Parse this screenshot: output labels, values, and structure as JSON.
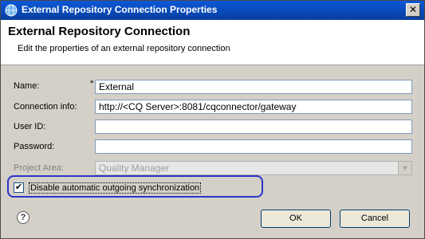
{
  "window": {
    "title": "External Repository Connection Properties",
    "close_glyph": "✕"
  },
  "header": {
    "title": "External Repository Connection",
    "description": "Edit the properties of an external repository connection"
  },
  "form": {
    "name_label": "Name:",
    "required_mark": "*",
    "name_value": "External",
    "connection_label": "Connection info:",
    "connection_value": "http://<CQ Server>:8081/cqconnector/gateway",
    "userid_label": "User ID:",
    "userid_value": "",
    "password_label": "Password:",
    "password_value": "",
    "project_area_label": "Project Area:",
    "project_area_value": "Quality Manager"
  },
  "sync": {
    "checked": true,
    "check_glyph": "✔",
    "label": "Disable automatic outgoing synchronization"
  },
  "footer": {
    "help_glyph": "?",
    "ok_label": "OK",
    "cancel_label": "Cancel"
  },
  "colors": {
    "titlebar": "#0a58d8",
    "highlight": "#2b34c9",
    "dialog_bg": "#d4d0c8"
  },
  "icons": {
    "app": "eclipse-globe-icon",
    "close": "close-icon",
    "help": "help-icon",
    "dropdown": "chevron-down-icon"
  }
}
